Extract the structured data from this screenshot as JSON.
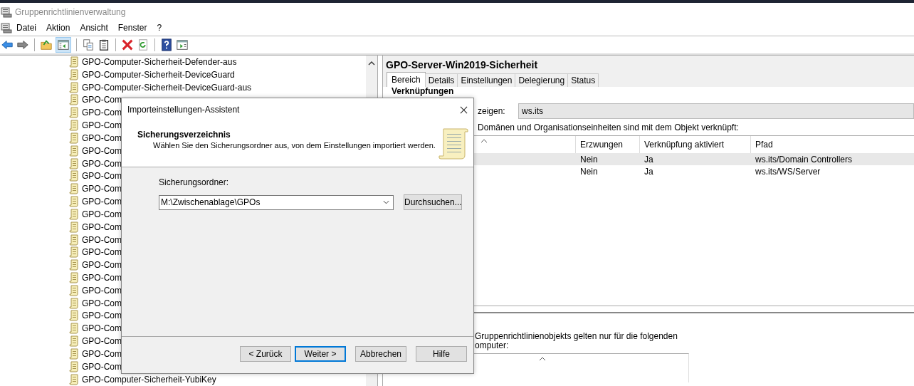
{
  "window": {
    "title": "Gruppenrichtlinienverwaltung"
  },
  "menu": [
    "Datei",
    "Aktion",
    "Ansicht",
    "Fenster",
    "?"
  ],
  "tree": {
    "items": [
      {
        "label": "GPO-Computer-Sicherheit-Defender-aus"
      },
      {
        "label": "GPO-Computer-Sicherheit-DeviceGuard"
      },
      {
        "label": "GPO-Computer-Sicherheit-DeviceGuard-aus"
      },
      {
        "label": "GPO-Com"
      },
      {
        "label": "GPO-Com"
      },
      {
        "label": "GPO-Com"
      },
      {
        "label": "GPO-Com"
      },
      {
        "label": "GPO-Com"
      },
      {
        "label": "GPO-Com"
      },
      {
        "label": "GPO-Com"
      },
      {
        "label": "GPO-Com"
      },
      {
        "label": "GPO-Com"
      },
      {
        "label": "GPO-Com"
      },
      {
        "label": "GPO-Com"
      },
      {
        "label": "GPO-Com"
      },
      {
        "label": "GPO-Com"
      },
      {
        "label": "GPO-Com"
      },
      {
        "label": "GPO-Com"
      },
      {
        "label": "GPO-Com"
      },
      {
        "label": "GPO-Com"
      },
      {
        "label": "GPO-Com"
      },
      {
        "label": "GPO-Com"
      },
      {
        "label": "GPO-Com"
      },
      {
        "label": "GPO-Com"
      },
      {
        "label": "GPO-Com"
      },
      {
        "label": "GPO-Computer-Sicherheit-YubiKey"
      }
    ]
  },
  "details": {
    "title": "GPO-Server-Win2019-Sicherheit",
    "tabs": [
      {
        "label": "Bereich",
        "selected": true
      },
      {
        "label": "Details",
        "selected": false
      },
      {
        "label": "Einstellungen",
        "selected": false
      },
      {
        "label": "Delegierung",
        "selected": false
      },
      {
        "label": "Status",
        "selected": false
      }
    ],
    "section_heading": "Verknüpfungen",
    "scope_label": "zeigen:",
    "scope_value": "ws.its",
    "links_caption": "Domänen und Organisationseinheiten sind mit dem Objekt verknüpft:",
    "links_table": {
      "columns": [
        "Erzwungen",
        "Verknüpfung aktiviert",
        "Pfad"
      ],
      "rows": [
        {
          "cells": [
            "Nein",
            "Ja",
            "ws.its/Domain Controllers"
          ],
          "selected": true
        },
        {
          "cells": [
            "Nein",
            "Ja",
            "ws.its/WS/Server"
          ],
          "selected": false
        }
      ]
    },
    "filter_text": [
      "Gruppenrichtlinienobjekts gelten nur für die folgenden",
      "omputer:"
    ]
  },
  "dialog": {
    "title": "Importeinstellungen-Assistent",
    "heading": "Sicherungsverzeichnis",
    "description": "Wählen Sie den Sicherungsordner aus, von dem Einstellungen importiert werden.",
    "folder_label": "Sicherungsordner:",
    "folder_value": "M:\\Zwischenablage\\GPOs",
    "browse_button": "Durchsuchen...",
    "buttons": [
      {
        "label": "< Zurück",
        "default": false
      },
      {
        "label": "Weiter >",
        "default": true
      },
      {
        "label": "Abbrechen",
        "default": false
      },
      {
        "label": "Hilfe",
        "default": false
      }
    ]
  }
}
